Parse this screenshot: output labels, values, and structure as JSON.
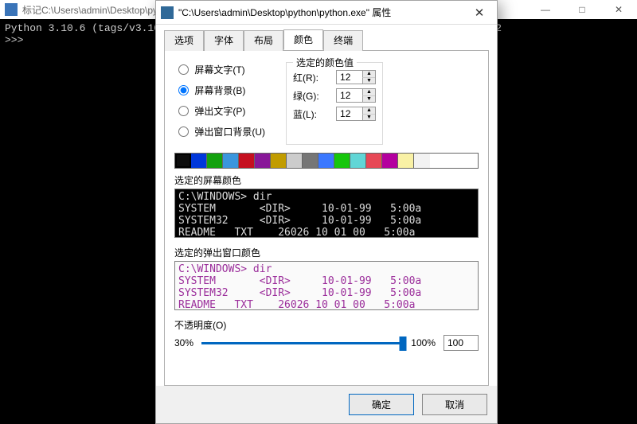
{
  "main_window": {
    "title": "标记C:\\Users\\admin\\Desktop\\python\\",
    "console_line1": "Python 3.10.6 (tags/v3.10.                                        D64)] on win32",
    "console_line2": ">>>"
  },
  "dialog": {
    "title": "\"C:\\Users\\admin\\Desktop\\python\\python.exe\" 属性",
    "tabs": [
      "选项",
      "字体",
      "布局",
      "颜色",
      "终端"
    ],
    "selected_tab_index": 3,
    "radios": {
      "screen_text": "屏幕文字(T)",
      "screen_bg": "屏幕背景(B)",
      "popup_text": "弹出文字(P)",
      "popup_bg": "弹出窗口背景(U)",
      "selected": "screen_bg"
    },
    "color_values": {
      "legend": "选定的颜色值",
      "red_label": "红(R):",
      "green_label": "绿(G):",
      "blue_label": "蓝(L):",
      "red": "12",
      "green": "12",
      "blue": "12"
    },
    "swatches": [
      "#0c0c0c",
      "#0037da",
      "#13a10e",
      "#3a96dd",
      "#c50f1f",
      "#881798",
      "#c19c00",
      "#cccccc",
      "#767676",
      "#3b78ff",
      "#16c60c",
      "#61d6d6",
      "#e74856",
      "#b4009e",
      "#f9f1a5",
      "#f2f2f2"
    ],
    "selected_swatch_index": 0,
    "preview_screen": {
      "label": "选定的屏幕颜色",
      "line1": "C:\\WINDOWS> dir",
      "line2": "SYSTEM       <DIR>     10-01-99   5:00a",
      "line3": "SYSTEM32     <DIR>     10-01-99   5:00a",
      "line4": "README   TXT    26026 10 01 00   5:00a"
    },
    "preview_popup": {
      "label": "选定的弹出窗口颜色",
      "line1": "C:\\WINDOWS> dir",
      "line2": "SYSTEM       <DIR>     10-01-99   5:00a",
      "line3": "SYSTEM32     <DIR>     10-01-99   5:00a",
      "line4": "README   TXT    26026 10 01 00   5:00a"
    },
    "opacity": {
      "label": "不透明度(O)",
      "min_label": "30%",
      "max_label": "100%",
      "value": "100",
      "fill_percent": 100,
      "thumb_percent": 100
    },
    "buttons": {
      "ok": "确定",
      "cancel": "取消"
    }
  }
}
